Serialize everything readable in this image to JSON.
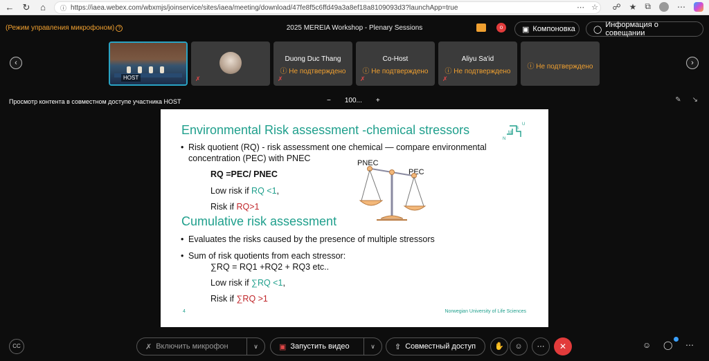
{
  "browser": {
    "url": "https://iaea.webex.com/wbxmjs/joinservice/sites/iaea/meeting/download/47fe8f5c6ffd49a3a8ef18a8109093d3?launchApp=true"
  },
  "topbar": {
    "mic_mode": "(Режим управления микрофоном)",
    "meeting_title": "2025 MEREIA Workshop - Plenary Sessions",
    "layout_label": "Компоновка",
    "info_label": "Информация о совещании",
    "rec_badge": "o"
  },
  "participants": [
    {
      "name": "",
      "warning": "",
      "host_label": "HOST"
    },
    {
      "name": "",
      "warning": ""
    },
    {
      "name": "Duong Duc Thang",
      "warning": "Не подтверждено"
    },
    {
      "name": "Co-Host",
      "warning": "Не подтверждено"
    },
    {
      "name": "Aliyu Sa'id",
      "warning": "Не подтверждено"
    },
    {
      "name": "",
      "warning": "Не подтверждено"
    }
  ],
  "share": {
    "label": "Просмотр контента в совместном доступе участника HOST",
    "zoom": "100...",
    "minus": "−",
    "plus": "+"
  },
  "slide": {
    "title1": "Environmental Risk assessment  -chemical stressors",
    "bullet1_line1": "Risk quotient (RQ) - risk assessment one chemical — compare environmental",
    "bullet1_line2": "concentration (PEC) with PNEC",
    "formula": "RQ =PEC/ PNEC",
    "low_risk_prefix": "Low risk if ",
    "low_risk_val": "RQ <1",
    "low_risk_suffix": ",",
    "risk_prefix": "Risk if ",
    "risk_val": "RQ>1",
    "pnec": "PNEC",
    "pec": "PEC",
    "title2": "Cumulative risk assessment",
    "bullet2": "Evaluates the risks caused by the presence of multiple stressors",
    "bullet3": "Sum of risk quotients from each stressor:",
    "sum_formula": "∑RQ = RQ1 +RQ2 + RQ3 etc..",
    "low_risk2_prefix": "Low risk if ",
    "low_risk2_val": "∑RQ <1",
    "low_risk2_suffix": ",",
    "risk2_prefix": "Risk if ",
    "risk2_val": "∑RQ >1",
    "page": "4",
    "university": "Norwegian University of Life Sciences",
    "logo_letters": "NMBU"
  },
  "controls": {
    "mic": "Включить микрофон",
    "video": "Запустить видео",
    "share": "Совместный доступ",
    "cc": "CC"
  },
  "colors": {
    "accent_orange": "#f0a030",
    "slide_teal": "#1f9f8c",
    "risk_red": "#c0262a",
    "end_call": "#e23b3b",
    "host_border": "#29a3c4"
  }
}
